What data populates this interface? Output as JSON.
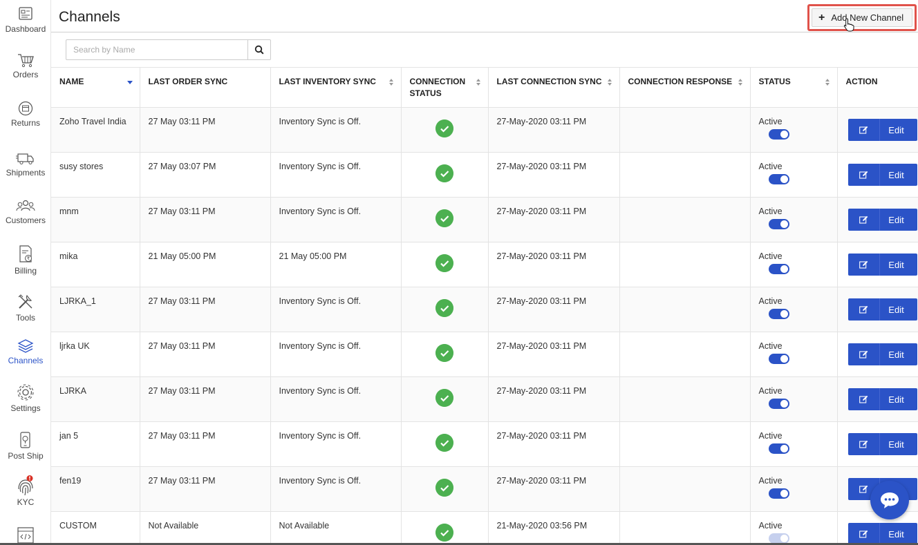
{
  "sidebar": {
    "items": [
      {
        "label": "Dashboard",
        "icon": "dashboard-icon"
      },
      {
        "label": "Orders",
        "icon": "cart-icon"
      },
      {
        "label": "Returns",
        "icon": "returns-icon"
      },
      {
        "label": "Shipments",
        "icon": "truck-icon"
      },
      {
        "label": "Customers",
        "icon": "customers-icon"
      },
      {
        "label": "Billing",
        "icon": "billing-icon"
      },
      {
        "label": "Tools",
        "icon": "tools-icon"
      },
      {
        "label": "Channels",
        "icon": "layers-icon",
        "active": true
      },
      {
        "label": "Settings",
        "icon": "gear-icon"
      },
      {
        "label": "Post Ship",
        "icon": "post-ship-icon"
      },
      {
        "label": "KYC",
        "icon": "fingerprint-icon",
        "badge": "!"
      }
    ]
  },
  "header": {
    "title": "Channels",
    "add_button_label": "Add New Channel"
  },
  "search": {
    "placeholder": "Search by Name",
    "value": ""
  },
  "table": {
    "columns": [
      {
        "label": "NAME",
        "sort": "desc"
      },
      {
        "label": "LAST ORDER SYNC",
        "sort": "none"
      },
      {
        "label": "LAST INVENTORY SYNC",
        "sort": "both"
      },
      {
        "label": "CONNECTION STATUS",
        "sort": "both"
      },
      {
        "label": "LAST CONNECTION SYNC",
        "sort": "both"
      },
      {
        "label": "CONNECTION RESPONSE",
        "sort": "both"
      },
      {
        "label": "STATUS",
        "sort": "both"
      },
      {
        "label": "ACTION",
        "sort": "none"
      }
    ],
    "rows": [
      {
        "name": "Zoho Travel India",
        "last_order_sync": "27 May 03:11 PM",
        "last_inventory_sync": "Inventory Sync is Off.",
        "connection_status": "connected",
        "last_connection_sync": "27-May-2020 03:11 PM",
        "connection_response": "",
        "status": "Active",
        "toggle_on": true,
        "action": "Edit"
      },
      {
        "name": "susy stores",
        "last_order_sync": "27 May 03:07 PM",
        "last_inventory_sync": "Inventory Sync is Off.",
        "connection_status": "connected",
        "last_connection_sync": "27-May-2020 03:11 PM",
        "connection_response": "",
        "status": "Active",
        "toggle_on": true,
        "action": "Edit"
      },
      {
        "name": "mnm",
        "last_order_sync": "27 May 03:11 PM",
        "last_inventory_sync": "Inventory Sync is Off.",
        "connection_status": "connected",
        "last_connection_sync": "27-May-2020 03:11 PM",
        "connection_response": "",
        "status": "Active",
        "toggle_on": true,
        "action": "Edit"
      },
      {
        "name": "mika",
        "last_order_sync": "21 May 05:00 PM",
        "last_inventory_sync": "21 May 05:00 PM",
        "connection_status": "connected",
        "last_connection_sync": "27-May-2020 03:11 PM",
        "connection_response": "",
        "status": "Active",
        "toggle_on": true,
        "action": "Edit"
      },
      {
        "name": "LJRKA_1",
        "last_order_sync": "27 May 03:11 PM",
        "last_inventory_sync": "Inventory Sync is Off.",
        "connection_status": "connected",
        "last_connection_sync": "27-May-2020 03:11 PM",
        "connection_response": "",
        "status": "Active",
        "toggle_on": true,
        "action": "Edit"
      },
      {
        "name": "ljrka UK",
        "last_order_sync": "27 May 03:11 PM",
        "last_inventory_sync": "Inventory Sync is Off.",
        "connection_status": "connected",
        "last_connection_sync": "27-May-2020 03:11 PM",
        "connection_response": "",
        "status": "Active",
        "toggle_on": true,
        "action": "Edit"
      },
      {
        "name": "LJRKA",
        "last_order_sync": "27 May 03:11 PM",
        "last_inventory_sync": "Inventory Sync is Off.",
        "connection_status": "connected",
        "last_connection_sync": "27-May-2020 03:11 PM",
        "connection_response": "",
        "status": "Active",
        "toggle_on": true,
        "action": "Edit"
      },
      {
        "name": "jan 5",
        "last_order_sync": "27 May 03:11 PM",
        "last_inventory_sync": "Inventory Sync is Off.",
        "connection_status": "connected",
        "last_connection_sync": "27-May-2020 03:11 PM",
        "connection_response": "",
        "status": "Active",
        "toggle_on": true,
        "action": "Edit"
      },
      {
        "name": "fen19",
        "last_order_sync": "27 May 03:11 PM",
        "last_inventory_sync": "Inventory Sync is Off.",
        "connection_status": "connected",
        "last_connection_sync": "27-May-2020 03:11 PM",
        "connection_response": "",
        "status": "Active",
        "toggle_on": true,
        "action": "Edit"
      },
      {
        "name": "CUSTOM",
        "last_order_sync": "Not Available",
        "last_inventory_sync": "Not Available",
        "connection_status": "connected",
        "last_connection_sync": "21-May-2020 03:56 PM",
        "connection_response": "",
        "status": "Active",
        "toggle_on": false,
        "action": "Edit"
      }
    ]
  },
  "colors": {
    "accent": "#2b53c7",
    "success": "#4cb050",
    "highlight_border": "#e0524a"
  }
}
